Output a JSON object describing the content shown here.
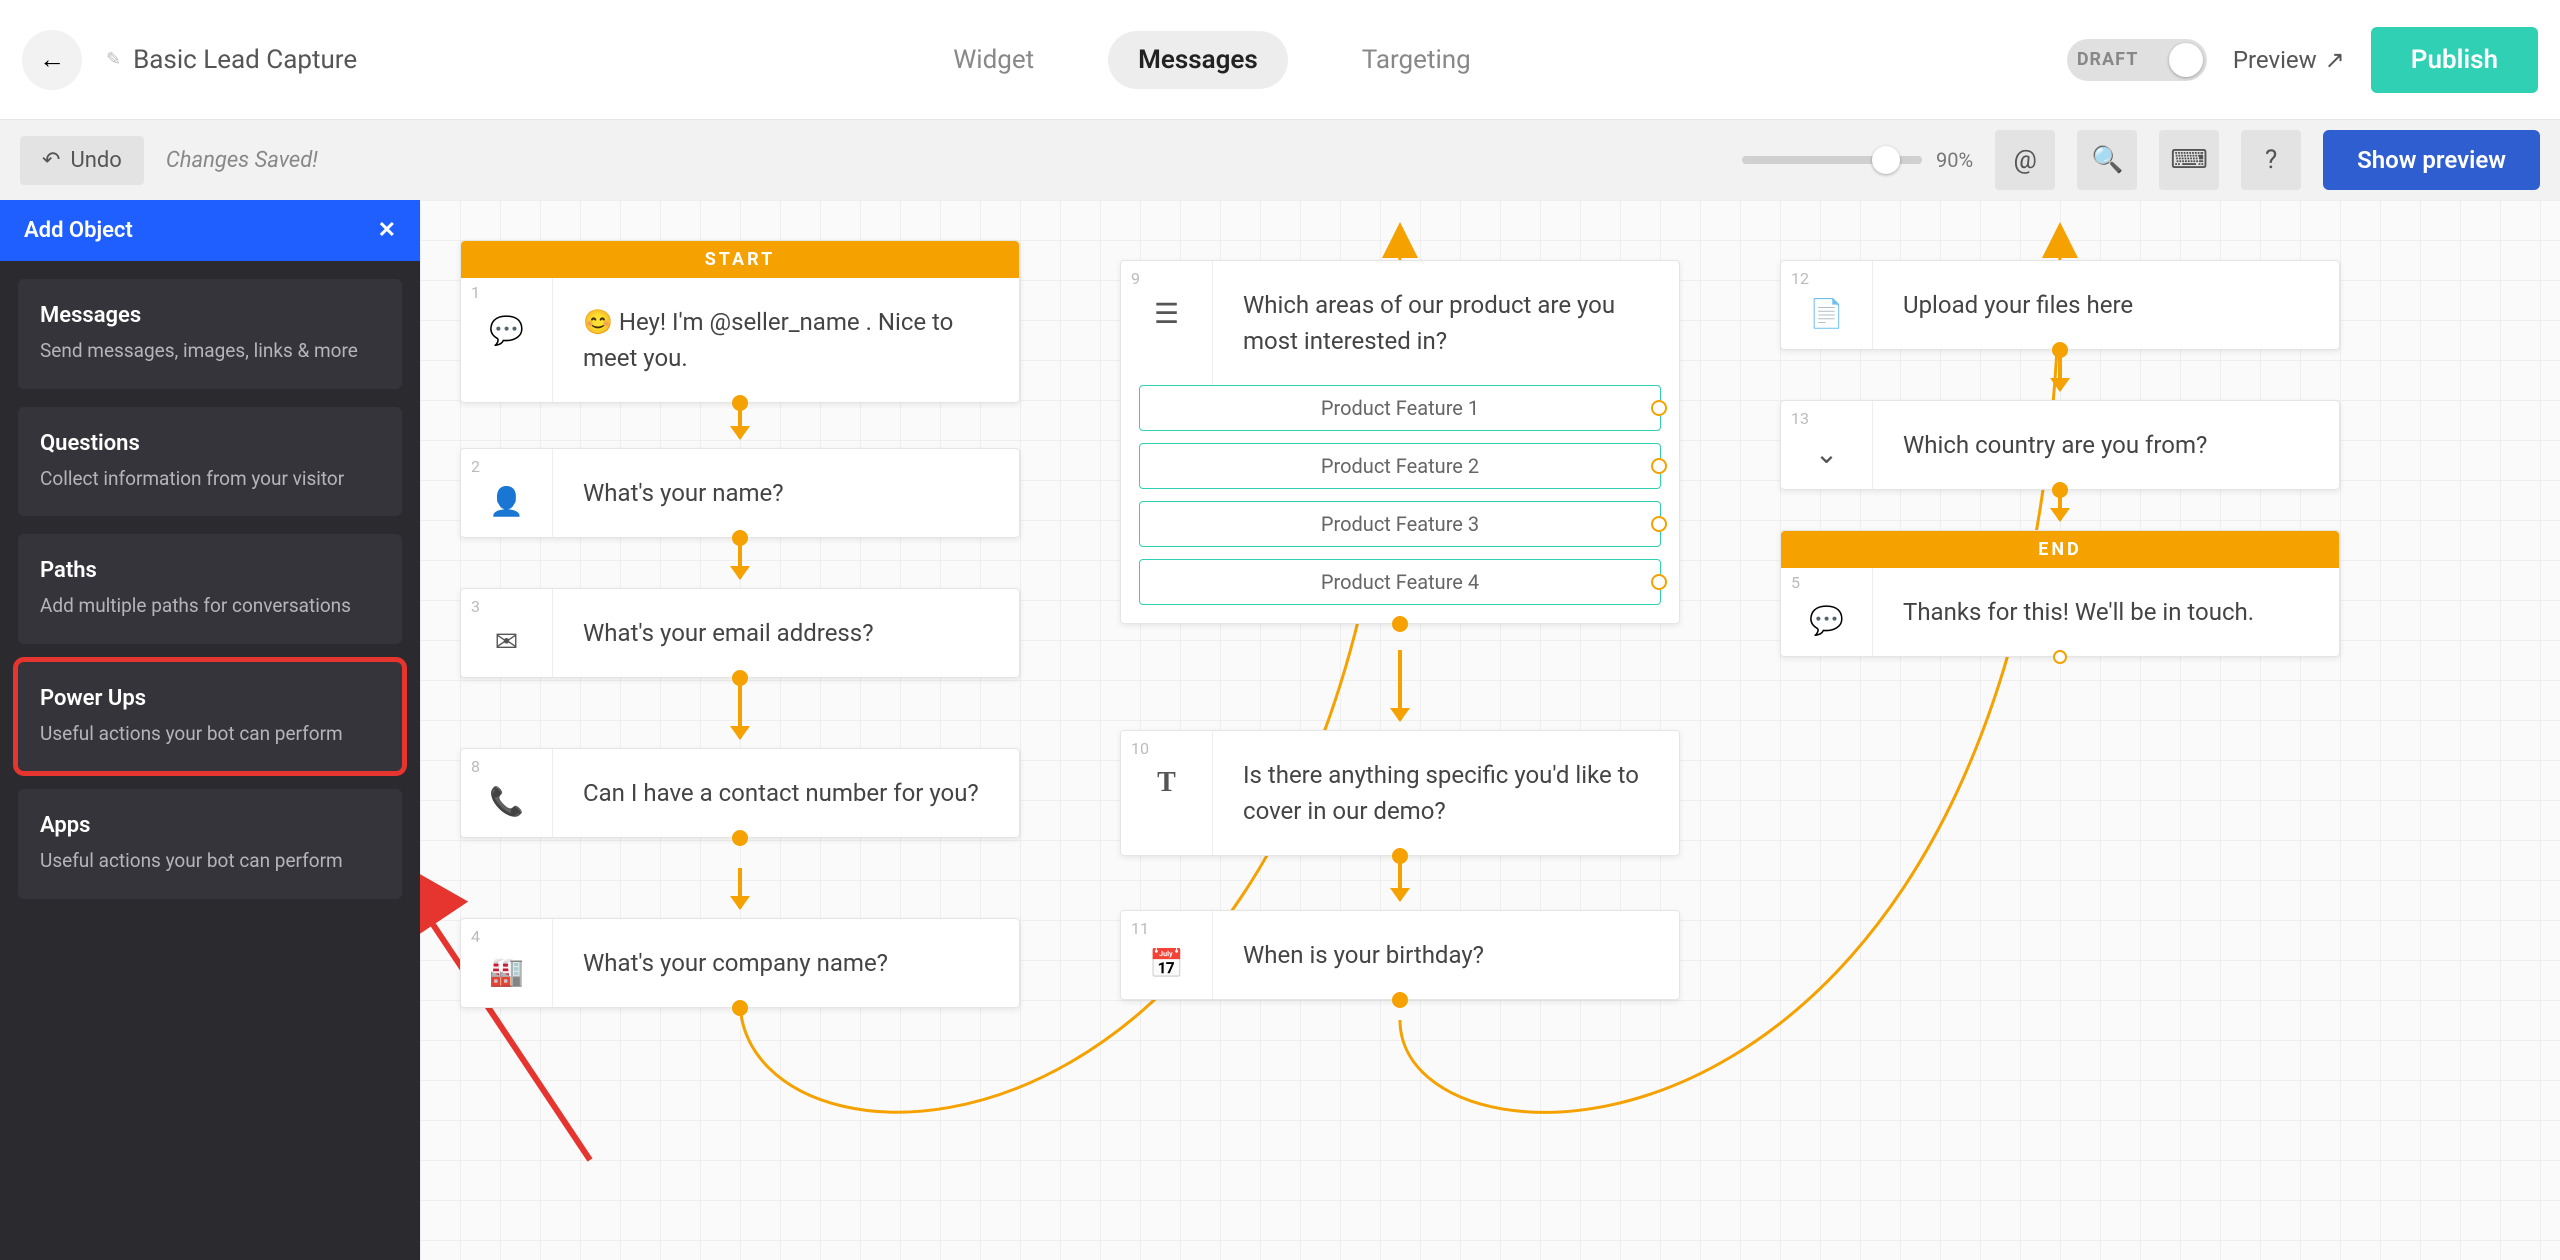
{
  "topbar": {
    "title": "Basic Lead Capture",
    "tabs": {
      "widget": "Widget",
      "messages": "Messages",
      "targeting": "Targeting"
    },
    "draft_label": "DRAFT",
    "preview_link": "Preview",
    "publish": "Publish"
  },
  "subbar": {
    "undo": "Undo",
    "status": "Changes Saved!",
    "zoom": "90%",
    "show_preview": "Show preview"
  },
  "sidebar": {
    "header": "Add Object",
    "items": [
      {
        "title": "Messages",
        "desc": "Send messages, images, links & more"
      },
      {
        "title": "Questions",
        "desc": "Collect information from your visitor"
      },
      {
        "title": "Paths",
        "desc": "Add multiple paths for conversations"
      },
      {
        "title": "Power Ups",
        "desc": "Useful actions your bot can perform"
      },
      {
        "title": "Apps",
        "desc": "Useful actions your bot can perform"
      }
    ]
  },
  "flow": {
    "start_label": "START",
    "end_label": "END",
    "nodes": {
      "1": "😊 Hey! I'm @seller_name . Nice to meet you.",
      "2": "What's your name?",
      "3": "What's your email address?",
      "8": "Can I have a contact number for you?",
      "4": "What's your company name?",
      "9": "Which areas of our product are you most interested in?",
      "10": "Is there anything specific you'd like to cover in our demo?",
      "11": "When is your birthday?",
      "12": "Upload your files here",
      "13": "Which country are you from?",
      "5": "Thanks for this! We'll be in touch."
    },
    "options": [
      "Product Feature 1",
      "Product Feature 2",
      "Product Feature 3",
      "Product Feature 4"
    ]
  }
}
